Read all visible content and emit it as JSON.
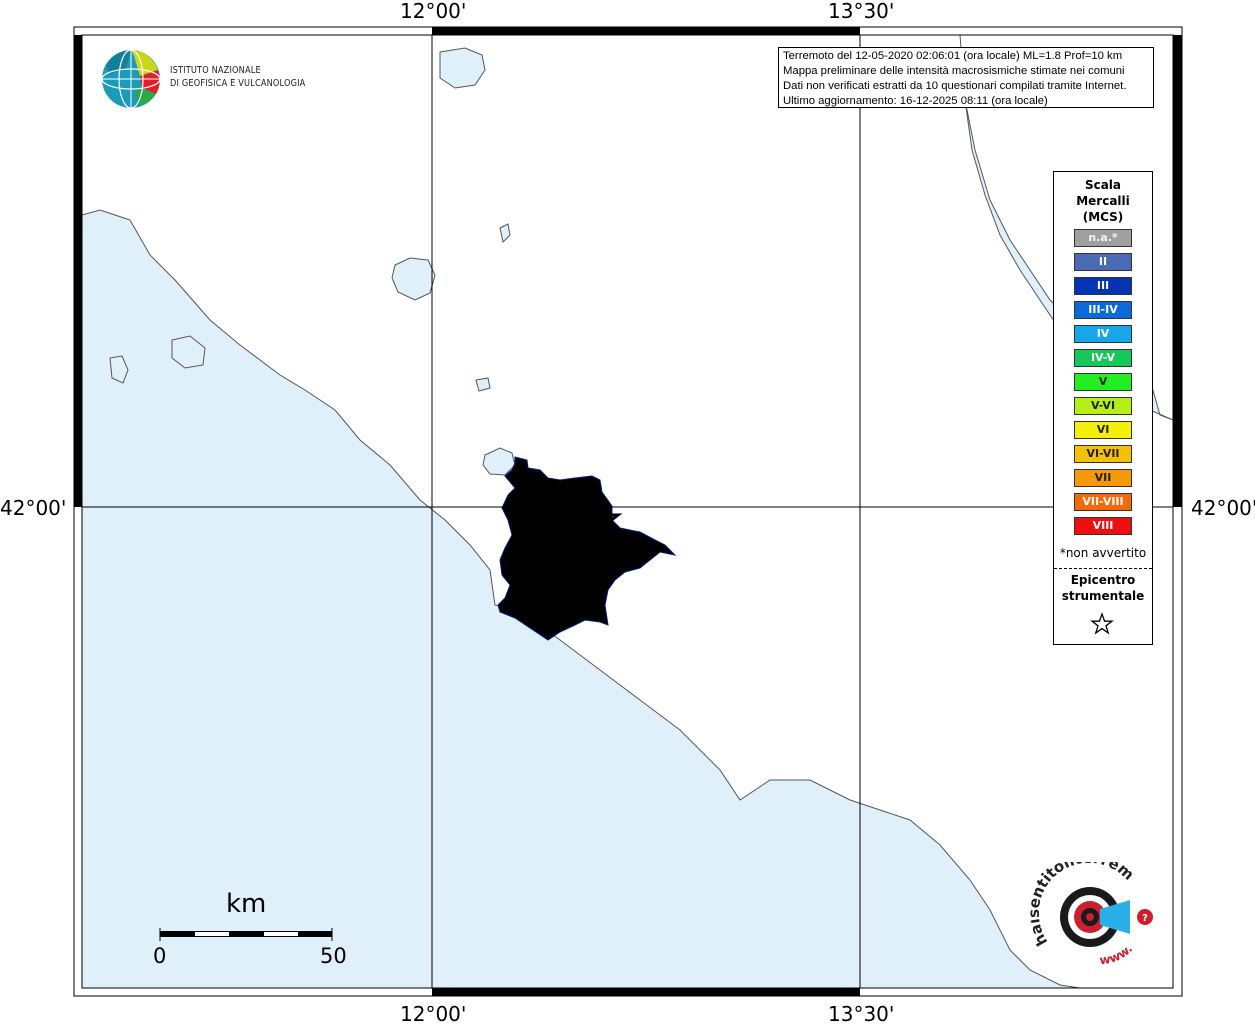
{
  "coords": {
    "top_lon_1": "12°00'",
    "top_lon_2": "13°30'",
    "bottom_lon_1": "12°00'",
    "bottom_lon_2": "13°30'",
    "left_lat": "42°00'",
    "right_lat": "42°00'"
  },
  "logo": {
    "line1": "ISTITUTO NAZIONALE",
    "line2": "DI GEOFISICA E VULCANOLOGIA"
  },
  "info": {
    "line1": "Terremoto del 12-05-2020 02:06:01 (ora locale) ML=1.8 Prof=10 km",
    "line2": "Mappa preliminare delle intensità macrosismiche stimate nei comuni",
    "line3": "Dati non verificati estratti da 10 questionari compilati tramite Internet.",
    "line4": "Ultimo aggiornamento: 16-12-2025 08:11 (ora locale)"
  },
  "legend": {
    "title_1": "Scala",
    "title_2": "Mercalli",
    "title_3": "(MCS)",
    "items": [
      {
        "label": "n.a.*",
        "color": "#a0a0a0"
      },
      {
        "label": "II",
        "color": "#4a6bb3"
      },
      {
        "label": "III",
        "color": "#0434b4"
      },
      {
        "label": "III-IV",
        "color": "#0a6ad8"
      },
      {
        "label": "IV",
        "color": "#16a6ea"
      },
      {
        "label": "IV-V",
        "color": "#16c85a"
      },
      {
        "label": "V",
        "color": "#22ee22"
      },
      {
        "label": "V-VI",
        "color": "#b4f018"
      },
      {
        "label": "VI",
        "color": "#f4f00a"
      },
      {
        "label": "VI-VII",
        "color": "#f4c00a"
      },
      {
        "label": "VII",
        "color": "#f49a0a"
      },
      {
        "label": "VII-VIII",
        "color": "#f46a0a"
      },
      {
        "label": "VIII",
        "color": "#ee1010"
      }
    ],
    "note": "*non avvertito",
    "epicenter_1": "Epicentro",
    "epicenter_2": "strumentale"
  },
  "scale": {
    "unit": "km",
    "min": "0",
    "max": "50"
  },
  "colors": {
    "sea": "#e0f0fb",
    "land": "#ffffff",
    "affected_area": "#0434b4"
  },
  "brand": {
    "hst_text": "haisentitoilterremoto.it",
    "hst_www": "www."
  }
}
